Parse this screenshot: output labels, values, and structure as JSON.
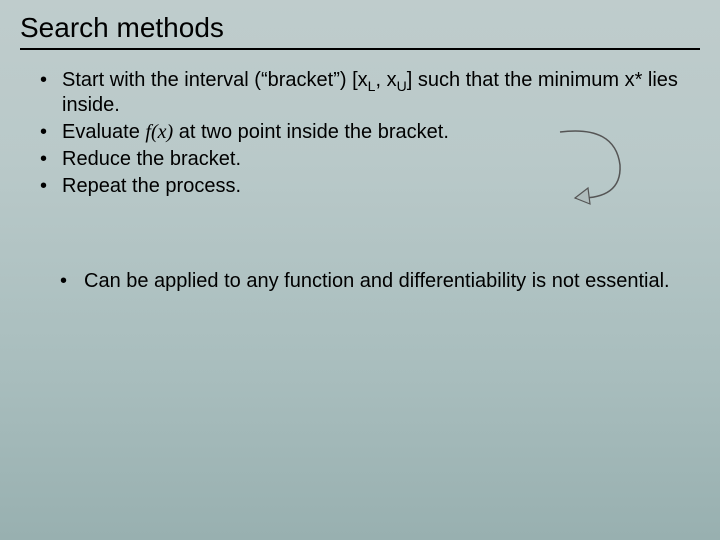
{
  "title": "Search methods",
  "bullets": {
    "b1_pre": "Start with the interval (“bracket”) [x",
    "b1_sub1": "L",
    "b1_mid": ", x",
    "b1_sub2": "U",
    "b1_post": "] such that the minimum x* lies inside.",
    "b2_pre": "Evaluate ",
    "b2_fx": "f(x)",
    "b2_post": " at two point inside the bracket.",
    "b3": "Reduce the bracket.",
    "b4": "Repeat the process."
  },
  "note": "Can be applied to any function and differentiability is not essential.",
  "arrow_icon": "curved-loop-arrow"
}
